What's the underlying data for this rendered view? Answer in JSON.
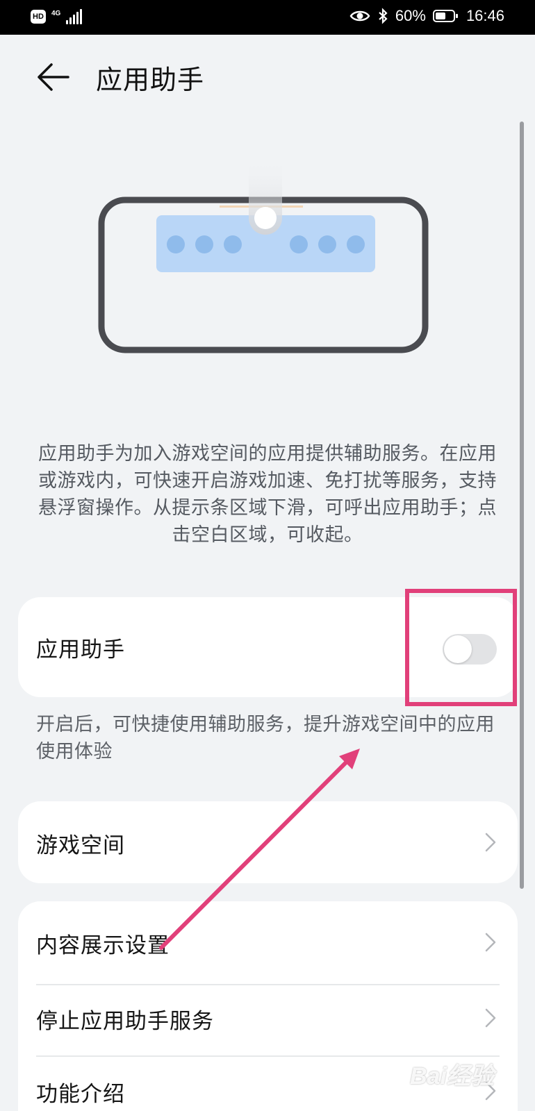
{
  "status_bar": {
    "hd": "HD",
    "network": "4G",
    "battery": "60%",
    "battery_level": 0.6,
    "time": "16:46",
    "icons": [
      "eye-comfort-icon",
      "bluetooth-icon",
      "battery-icon",
      "signal-icon"
    ]
  },
  "header": {
    "title": "应用助手",
    "back_icon": "back-arrow-icon"
  },
  "description": "应用助手为加入游戏空间的应用提供辅助服务。在应用或游戏内，可快速开启游戏加速、免打扰等服务，支持悬浮窗操作。从提示条区域下滑，可呼出应用助手；点击空白区域，可收起。",
  "assistant_toggle": {
    "label": "应用助手",
    "enabled": false
  },
  "helper_text": "开启后，可快捷使用辅助服务，提升游戏空间中的应用使用体验",
  "game_space": {
    "label": "游戏空间"
  },
  "settings": [
    {
      "label": "内容展示设置"
    },
    {
      "label": "停止应用助手服务"
    },
    {
      "label": "功能介绍"
    }
  ],
  "watermark": "Bai经验",
  "colors": {
    "background": "#f1f3f5",
    "annotation": "#e1407a",
    "illustration_blue": "#b9d6f7",
    "toggle_off": "#e2e3e5"
  }
}
